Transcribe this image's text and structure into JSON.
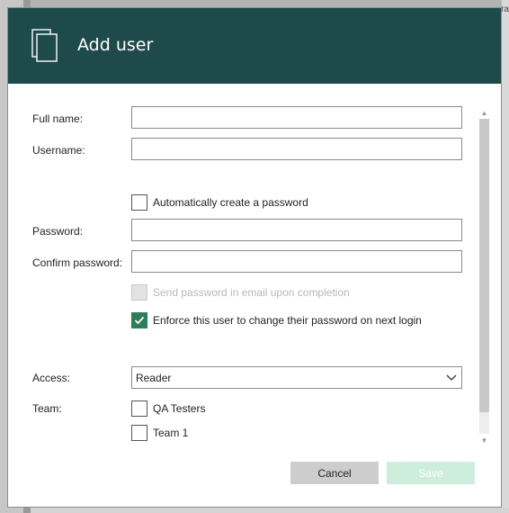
{
  "background": {
    "edge_text": "ra"
  },
  "dialog": {
    "title": "Add user",
    "header_icon": "documents-icon",
    "header_color": "#1f4a4b"
  },
  "form": {
    "full_name": {
      "label": "Full name:",
      "value": ""
    },
    "username": {
      "label": "Username:",
      "value": ""
    },
    "auto_password": {
      "label": "Automatically create a password",
      "checked": false
    },
    "password": {
      "label": "Password:",
      "value": ""
    },
    "confirm_password": {
      "label": "Confirm password:",
      "value": ""
    },
    "send_email": {
      "label": "Send password in email upon completion",
      "checked": false,
      "disabled": true
    },
    "enforce_change": {
      "label": "Enforce this user to change their password on next login",
      "checked": true
    },
    "access": {
      "label": "Access:",
      "value": "Reader"
    },
    "team": {
      "label": "Team:",
      "options": [
        {
          "label": "QA Testers",
          "checked": false
        },
        {
          "label": "Team 1",
          "checked": false
        }
      ]
    }
  },
  "buttons": {
    "cancel": "Cancel",
    "save": "Save"
  },
  "colors": {
    "accent": "#2e7d5b",
    "save_disabled": "#cdeedd"
  }
}
